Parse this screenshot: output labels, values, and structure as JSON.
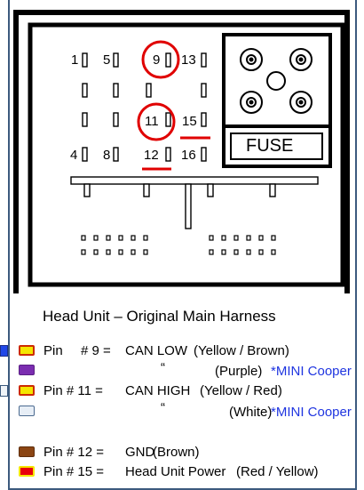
{
  "diagram": {
    "title": "Head Unit – Original Main Harness",
    "fuse_label": "FUSE",
    "pin_numbers": [
      "1",
      "5",
      "9",
      "13",
      "11",
      "15",
      "4",
      "8",
      "12",
      "16"
    ],
    "highlighted_pins": [
      "9",
      "11",
      "12",
      "15"
    ]
  },
  "legend": {
    "items": [
      {
        "color": "#f5e600",
        "border": "#cc2b00",
        "prefix": "Pin",
        "number": "# 9 =",
        "name": "CAN LOW",
        "desc": "(Yellow / Brown)",
        "note": ""
      },
      {
        "color": "#7b2db0",
        "border": "#5a1f84",
        "prefix": "",
        "number": "“",
        "name": "",
        "desc": "(Purple)",
        "note": "*MINI Cooper"
      },
      {
        "color": "#f5e600",
        "border": "#cc2b00",
        "prefix": "Pin # 11 =",
        "number": "",
        "name": "CAN HIGH",
        "desc": "(Yellow / Red)",
        "note": ""
      },
      {
        "color": "#e7eef6",
        "border": "#4b6a8f",
        "prefix": "",
        "number": "“",
        "name": "",
        "desc": "(White)",
        "note": "*MINI Cooper"
      },
      {
        "color": "#8b4513",
        "border": "#5e2e0c",
        "prefix": "Pin # 12 =",
        "number": "",
        "name": "GND",
        "desc": "(Brown)",
        "note": ""
      },
      {
        "color": "#e8000b",
        "border": "#f5e600",
        "prefix": "Pin # 15 =",
        "number": "",
        "name": "Head Unit Power",
        "desc": "(Red / Yellow)",
        "note": ""
      }
    ]
  }
}
